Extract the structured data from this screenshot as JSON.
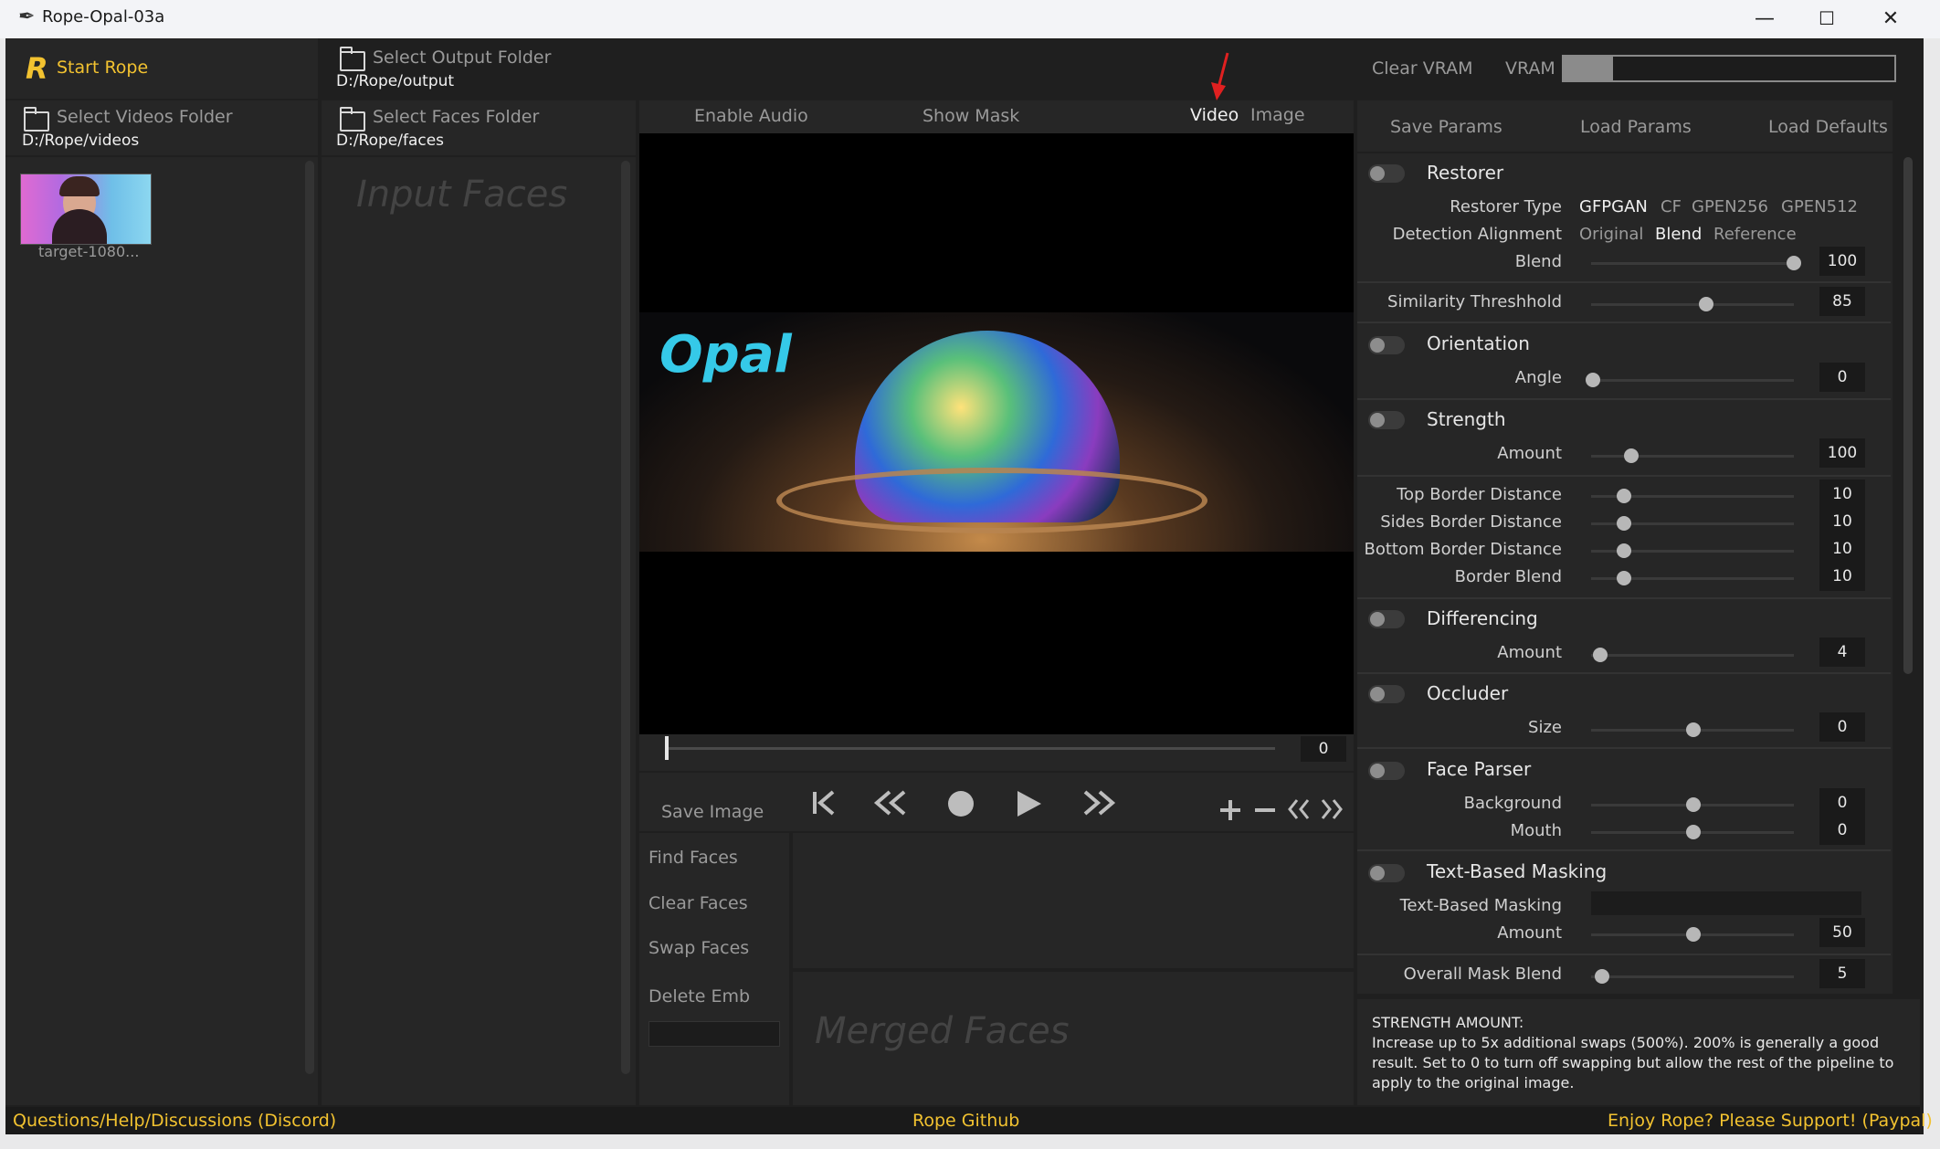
{
  "window": {
    "title": "Rope-Opal-03a",
    "minimize": "—",
    "maximize": "☐",
    "close": "✕"
  },
  "top": {
    "start_rope": "Start Rope",
    "select_output_folder": "Select Output Folder",
    "output_path": "D:/Rope/output",
    "clear_vram": "Clear VRAM",
    "vram_label": "VRAM",
    "vram_fraction": 0.15
  },
  "left": {
    "select_videos_folder": "Select Videos Folder",
    "videos_path": "D:/Rope/videos",
    "thumbnail_label": "target-1080..."
  },
  "faces": {
    "select_faces_folder": "Select Faces Folder",
    "faces_path": "D:/Rope/faces",
    "input_faces_placeholder": "Input Faces"
  },
  "center": {
    "enable_audio": "Enable Audio",
    "show_mask": "Show Mask",
    "video_tab": "Video",
    "image_tab": "Image",
    "preview_text": "Opal",
    "frame_value": "0",
    "save_image": "Save Image",
    "find_faces": "Find Faces",
    "clear_faces": "Clear Faces",
    "swap_faces": "Swap Faces",
    "delete_emb": "Delete Emb",
    "merged_faces_placeholder": "Merged Faces"
  },
  "params": {
    "save_params": "Save Params",
    "load_params": "Load Params",
    "load_defaults": "Load Defaults",
    "restorer": {
      "title": "Restorer",
      "type_label": "Restorer Type",
      "types": [
        "GFPGAN",
        "CF",
        "GPEN256",
        "GPEN512"
      ],
      "alignment_label": "Detection Alignment",
      "alignments": [
        "Original",
        "Blend",
        "Reference"
      ],
      "blend_label": "Blend",
      "blend_value": "100"
    },
    "similarity": {
      "label": "Similarity Threshhold",
      "value": "85"
    },
    "orientation": {
      "title": "Orientation",
      "angle_label": "Angle",
      "angle_value": "0"
    },
    "strength": {
      "title": "Strength",
      "amount_label": "Amount",
      "amount_value": "100"
    },
    "borders": {
      "top_label": "Top Border Distance",
      "top_value": "10",
      "sides_label": "Sides Border Distance",
      "sides_value": "10",
      "bottom_label": "Bottom Border Distance",
      "bottom_value": "10",
      "blend_label": "Border Blend",
      "blend_value": "10"
    },
    "differencing": {
      "title": "Differencing",
      "amount_label": "Amount",
      "amount_value": "4"
    },
    "occluder": {
      "title": "Occluder",
      "size_label": "Size",
      "size_value": "0"
    },
    "face_parser": {
      "title": "Face Parser",
      "background_label": "Background",
      "background_value": "0",
      "mouth_label": "Mouth",
      "mouth_value": "0"
    },
    "text_masking": {
      "title": "Text-Based Masking",
      "field_label": "Text-Based Masking",
      "amount_label": "Amount",
      "amount_value": "50"
    },
    "overall_mask_blend": {
      "label": "Overall Mask Blend",
      "value": "5"
    },
    "help": {
      "heading": "STRENGTH AMOUNT:",
      "line1": "Increase up to 5x additional swaps (500%). 200% is generally a good",
      "line2": "result. Set to 0 to turn off swapping but allow the rest of the pipeline to",
      "line3": "apply to the original image."
    }
  },
  "footer": {
    "discord": "Questions/Help/Discussions (Discord)",
    "github": "Rope Github",
    "paypal": "Enjoy Rope? Please Support! (Paypal)"
  },
  "colors": {
    "accent_gold": "#f2c230",
    "opal_cyan": "#35c9e8",
    "background": "#1f1f1f"
  }
}
